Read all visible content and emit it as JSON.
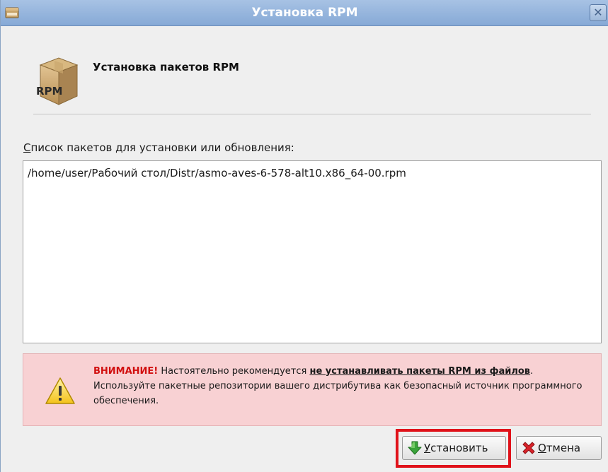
{
  "window": {
    "title": "Установка RPM",
    "close_glyph": "✕",
    "icon": "rpm-package-icon"
  },
  "header": {
    "icon_label": "RPM",
    "title": "Установка пакетов RPM"
  },
  "package_list": {
    "label_mnemonic": "С",
    "label_rest": "писок пакетов для установки или обновления:",
    "items": [
      "/home/user/Рабочий стол/Distr/asmo-aves-6-578-alt10.x86_64-00.rpm"
    ]
  },
  "warning": {
    "icon": "warning-icon",
    "attention": "ВНИМАНИЕ!",
    "text_before": " Настоятельно рекомендуется ",
    "emphasis": "не устанавливать пакеты RPM из файлов",
    "text_after": ". Используйте пакетные репозитории вашего дистрибутива как безопасный источник программного обеспечения."
  },
  "buttons": {
    "install": {
      "mnemonic": "У",
      "rest": "становить",
      "icon": "install-arrow-icon"
    },
    "cancel": {
      "mnemonic": "О",
      "rest": "тмена",
      "icon": "cancel-x-icon"
    }
  },
  "colors": {
    "titlebar": "#94b3dc",
    "warning_bg": "#f8d1d3",
    "attention_text": "#d10f0f",
    "highlight_frame": "#e0121a",
    "install_arrow": "#3aa33a",
    "cancel_x": "#d9232a"
  }
}
